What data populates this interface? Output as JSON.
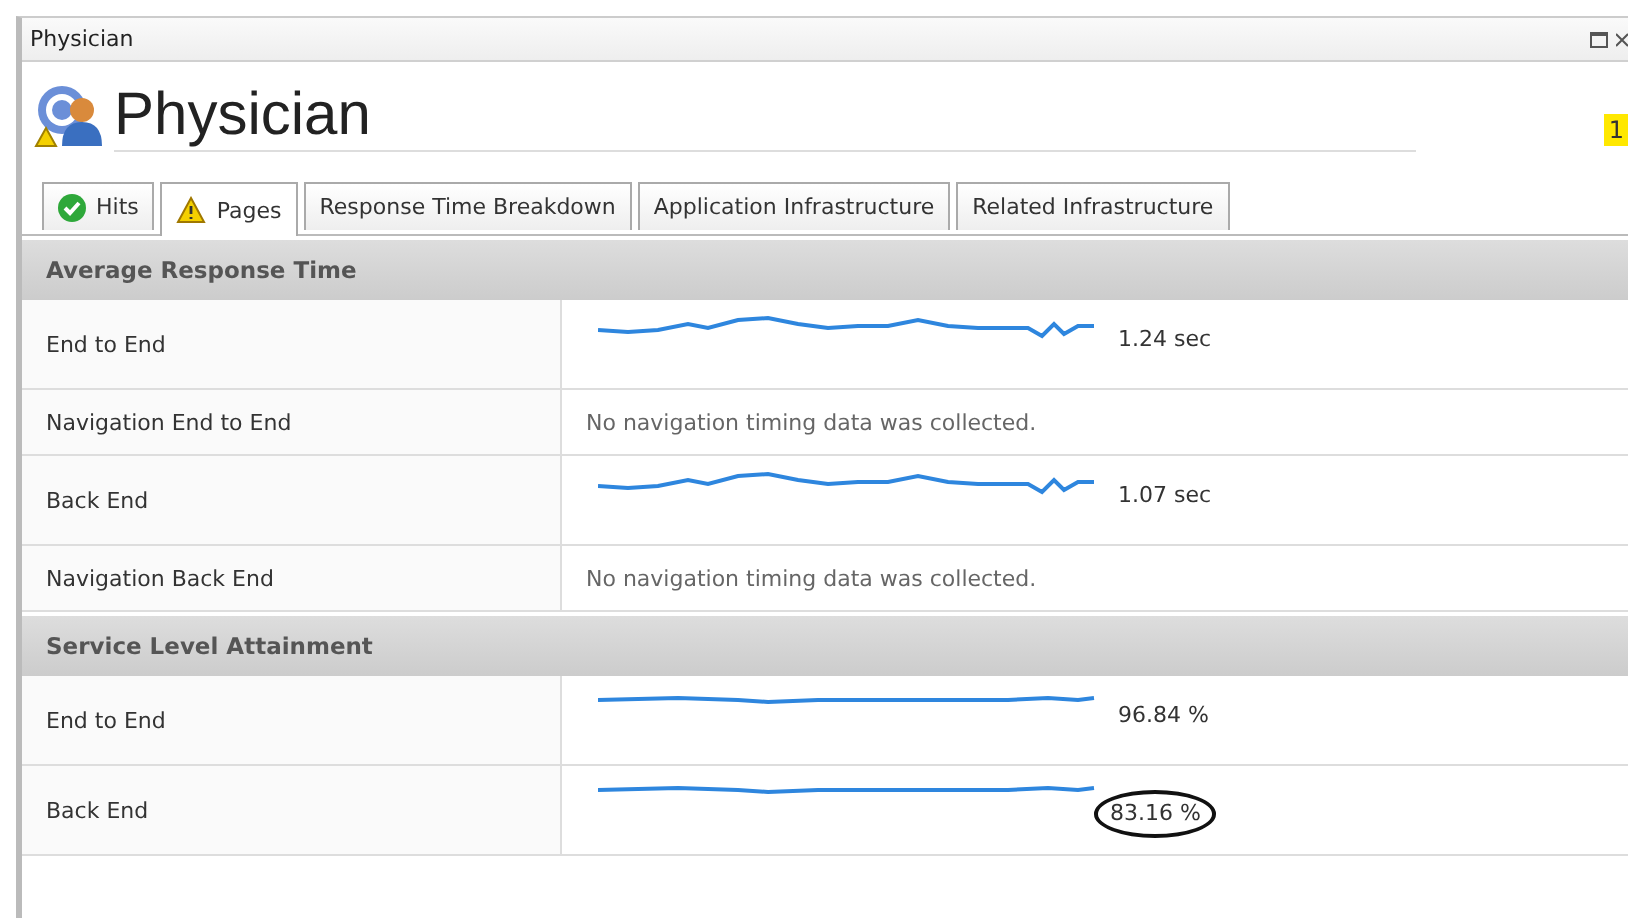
{
  "window": {
    "title": "Physician"
  },
  "header": {
    "title": "Physician",
    "badge": "1"
  },
  "tabs": [
    {
      "label": "Hits",
      "kind": "ok",
      "selected": false
    },
    {
      "label": "Pages",
      "kind": "warning",
      "selected": true
    },
    {
      "label": "Response Time Breakdown",
      "selected": false
    },
    {
      "label": "Application Infrastructure",
      "selected": false
    },
    {
      "label": "Related Infrastructure",
      "selected": false
    }
  ],
  "sections": [
    {
      "title": "Average Response Time",
      "rows": [
        {
          "label": "End to End",
          "kind": "sparkline",
          "value": "1.24 sec",
          "circled": false
        },
        {
          "label": "Navigation End to End",
          "kind": "message",
          "message": "No navigation timing data was collected."
        },
        {
          "label": "Back End",
          "kind": "sparkline",
          "value": "1.07 sec",
          "circled": false
        },
        {
          "label": "Navigation Back End",
          "kind": "message",
          "message": "No navigation timing data was collected."
        }
      ]
    },
    {
      "title": "Service Level Attainment",
      "rows": [
        {
          "label": "End to End",
          "kind": "sparkline",
          "value": "96.84 %",
          "circled": false
        },
        {
          "label": "Back End",
          "kind": "sparkline",
          "value": "83.16 %",
          "circled": true
        }
      ]
    }
  ]
}
